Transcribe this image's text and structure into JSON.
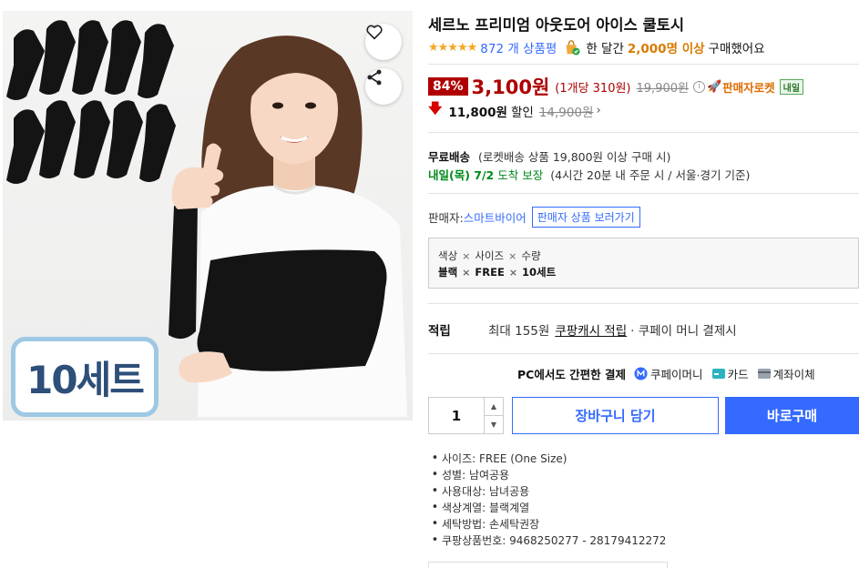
{
  "product": {
    "title": "세르노 프리미엄 아웃도어 아이스 쿨토시",
    "image_badge": "10세트"
  },
  "rating": {
    "stars_glyph": "★★★★★",
    "review_count": "872 개 상품평",
    "buyers_prefix": "한 달간",
    "buyers_count": "2,000명 이상",
    "buyers_suffix": "구매했어요"
  },
  "price": {
    "discount_rate": "84%",
    "sale_price": "3,100원",
    "unit_price": "(1개당 310원)",
    "original_price": "19,900원",
    "seller_rocket": "판매자로켓",
    "tomorrow_tag": "내일",
    "extra_discount_amount": "11,800원",
    "extra_discount_label": "할인",
    "extra_discount_from": "14,900원"
  },
  "shipping": {
    "free_label": "무료배송",
    "free_note": "(로켓배송 상품 19,800원 이상 구매 시)",
    "arrival_date": "내일(목) 7/2",
    "arrival_guarantee": "도착 보장",
    "arrival_note": "(4시간 20분 내 주문 시 / 서울·경기 기준)"
  },
  "seller": {
    "label": "판매자:",
    "name": "스마트바이어",
    "view_button": "판매자 상품 보러가기"
  },
  "option": {
    "headers": [
      "색상",
      "사이즈",
      "수량"
    ],
    "values": [
      "블랙",
      "FREE",
      "10세트"
    ],
    "separator": "×"
  },
  "points": {
    "label": "적립",
    "max_text": "최대 155원",
    "link_text": "쿠팡캐시 적립",
    "rest_text": "· 쿠페이 머니 결제시"
  },
  "payment": {
    "title": "PC에서도 간편한 결제",
    "methods": [
      "쿠페이머니",
      "카드",
      "계좌이체"
    ]
  },
  "purchase": {
    "quantity": "1",
    "cart_button": "장바구니 담기",
    "buy_button": "바로구매"
  },
  "attributes": [
    "사이즈: FREE (One Size)",
    "성별: 남여공용",
    "사용대상: 남녀공용",
    "색상계열: 블랙계열",
    "세탁방법: 손세탁권장",
    "쿠팡상품번호: 9468250277 - 28179412272"
  ],
  "colors": {
    "accent_blue": "#346aff",
    "price_red": "#ae0000",
    "arrival_green": "#00891a",
    "rocket_orange": "#e06b00",
    "star_orange": "#f5a623"
  },
  "icons": [
    "heart-icon",
    "share-icon",
    "shopping-bag-icon",
    "info-icon",
    "rocket-icon",
    "down-arrow-icon",
    "chevron-right-icon",
    "coupay-icon",
    "card-icon",
    "bank-icon",
    "quantity-up-icon",
    "quantity-down-icon"
  ]
}
